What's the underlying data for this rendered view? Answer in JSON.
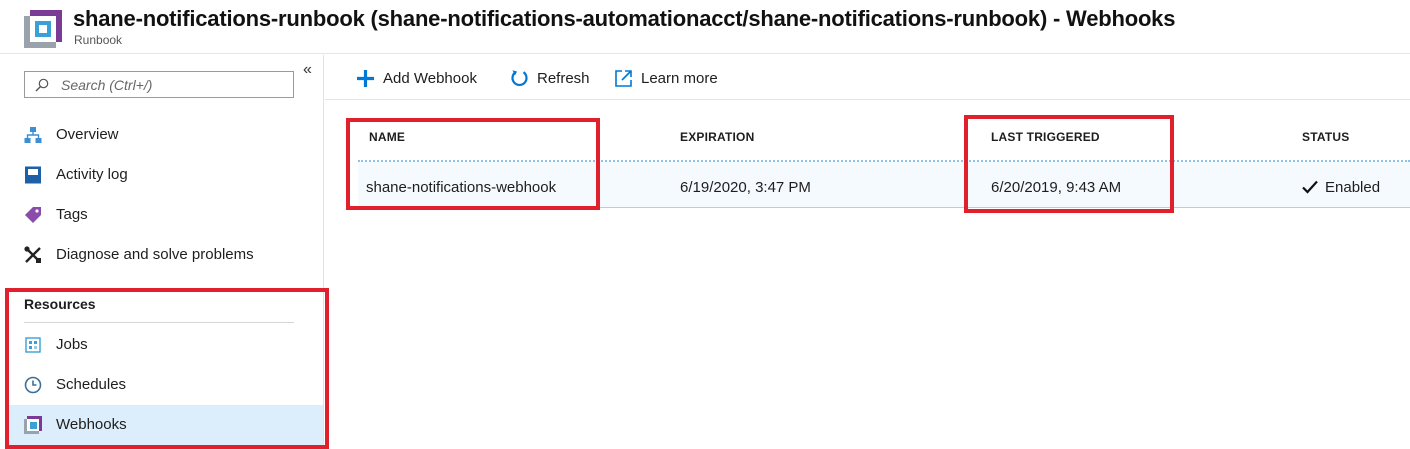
{
  "header": {
    "title": "shane-notifications-runbook (shane-notifications-automationacct/shane-notifications-runbook) - Webhooks",
    "subtitle": "Runbook"
  },
  "sidebar": {
    "search_placeholder": "Search (Ctrl+/)",
    "collapse_symbol": "«",
    "items": [
      {
        "label": "Overview",
        "icon": "overview-icon"
      },
      {
        "label": "Activity log",
        "icon": "activity-log-icon"
      },
      {
        "label": "Tags",
        "icon": "tag-icon"
      },
      {
        "label": "Diagnose and solve problems",
        "icon": "wrench-icon"
      }
    ],
    "section_title": "Resources",
    "resources": [
      {
        "label": "Jobs",
        "icon": "jobs-icon"
      },
      {
        "label": "Schedules",
        "icon": "clock-icon"
      },
      {
        "label": "Webhooks",
        "icon": "webhook-icon",
        "active": true
      }
    ]
  },
  "toolbar": {
    "add_label": "Add Webhook",
    "refresh_label": "Refresh",
    "learn_label": "Learn more"
  },
  "table": {
    "columns": [
      "NAME",
      "EXPIRATION",
      "LAST TRIGGERED",
      "STATUS"
    ],
    "rows": [
      {
        "name": "shane-notifications-webhook",
        "expiration": "6/19/2020, 3:47 PM",
        "last_triggered": "6/20/2019, 9:43 AM",
        "status": "Enabled"
      }
    ]
  },
  "colors": {
    "accent": "#0078d4",
    "highlight_box": "#e0202c",
    "active_row": "#dcedfb",
    "brand_purple": "#7a3b97"
  }
}
